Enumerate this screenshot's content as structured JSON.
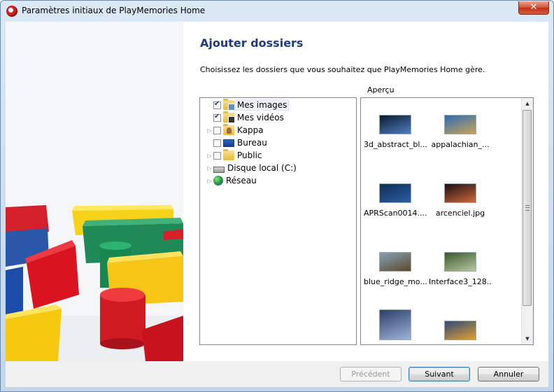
{
  "window": {
    "title": "Paramètres initiaux de PlayMemories Home",
    "close_glyph": "✕"
  },
  "page": {
    "heading": "Ajouter dossiers",
    "description": "Choisissez les dossiers que vous souhaitez que PlayMemories Home gère.",
    "preview_label": "Aperçu"
  },
  "tree": {
    "items": [
      {
        "label": "Mes images",
        "checked": true,
        "expandable": false,
        "icon": "pictures-library-icon"
      },
      {
        "label": "Mes vidéos",
        "checked": true,
        "expandable": false,
        "icon": "videos-library-icon"
      },
      {
        "label": "Kappa",
        "checked": false,
        "expandable": true,
        "icon": "user-folder-icon"
      },
      {
        "label": "Bureau",
        "checked": false,
        "expandable": false,
        "icon": "desktop-icon"
      },
      {
        "label": "Public",
        "checked": false,
        "expandable": true,
        "icon": "folder-icon"
      },
      {
        "label": "Disque local (C:)",
        "checked": null,
        "expandable": true,
        "icon": "local-disk-icon"
      },
      {
        "label": "Réseau",
        "checked": null,
        "expandable": true,
        "icon": "network-icon"
      }
    ]
  },
  "preview": {
    "thumbnails": [
      {
        "name": "3d_abstract_bl...",
        "colors": [
          "#0a1a33",
          "#4f7fbf"
        ]
      },
      {
        "name": "appalachian_...",
        "colors": [
          "#2d6ab3",
          "#c9a55a"
        ]
      },
      {
        "name": "APRScan0014....",
        "colors": [
          "#0f2d5a",
          "#2b5fa0"
        ]
      },
      {
        "name": "arcenciel.jpg",
        "colors": [
          "#1a0f14",
          "#d06a3a"
        ]
      },
      {
        "name": "blue_ridge_mo...",
        "colors": [
          "#8aa0b8",
          "#5a4a2a"
        ]
      },
      {
        "name": "Interface3_128...",
        "colors": [
          "#3c5a2d",
          "#b7c6a5"
        ]
      },
      {
        "name": "",
        "colors": [
          "#2b3f6b",
          "#9fb3d6"
        ]
      },
      {
        "name": "",
        "colors": [
          "#314a78",
          "#e0a030"
        ]
      }
    ]
  },
  "buttons": {
    "previous": "Précédent",
    "next": "Suivant",
    "cancel": "Annuler"
  }
}
